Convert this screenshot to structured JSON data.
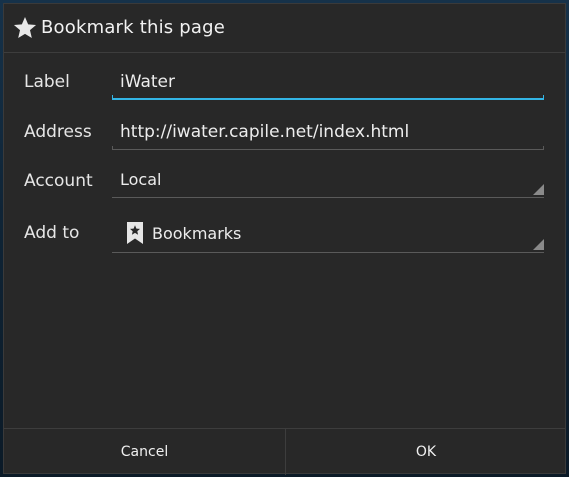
{
  "dialog": {
    "title": "Bookmark this page",
    "title_icon": "star-icon"
  },
  "form": {
    "label": {
      "caption": "Label",
      "value": "iWater",
      "focused": true
    },
    "address": {
      "caption": "Address",
      "value": "http://iwater.capile.net/index.html"
    },
    "account": {
      "caption": "Account",
      "value": "Local"
    },
    "add_to": {
      "caption": "Add to",
      "value": "Bookmarks",
      "icon": "bookmark-star-icon"
    }
  },
  "buttons": {
    "cancel": "Cancel",
    "ok": "OK"
  },
  "colors": {
    "focus_accent": "#33b5e5",
    "dialog_bg": "#282828"
  }
}
